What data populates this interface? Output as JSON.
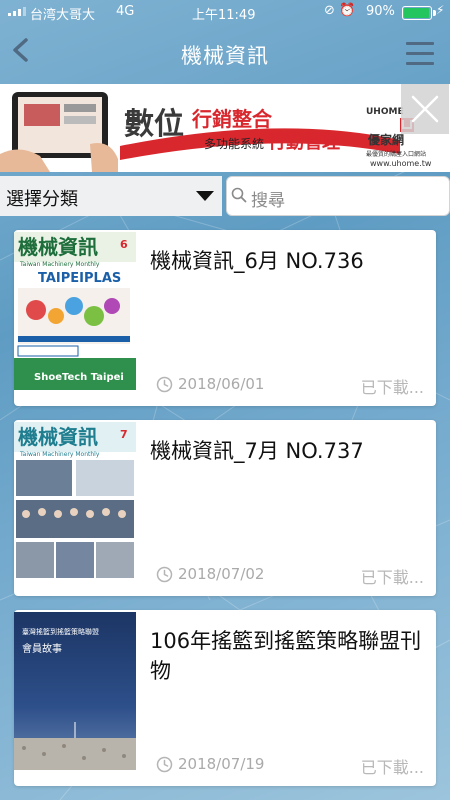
{
  "status_bar": {
    "carrier": "台湾大哥大",
    "network": "4G",
    "time": "上午11:49",
    "icons": "⊘ ⏰",
    "battery_percent": "90%",
    "battery_level": 0.9
  },
  "nav": {
    "title": "機械資訊",
    "back_icon": "chevron-left-icon",
    "menu_icon": "hamburger-menu-icon"
  },
  "banner": {
    "headline": "數位",
    "headline_red": "行銷整合",
    "subline": "多功能系統",
    "subline_red": "行動管理",
    "brand_latin": "UHOME",
    "brand_cn": "優家網",
    "brand_tagline": "最優質的購屋入口網站",
    "brand_url": "www.uhome.tw"
  },
  "filter": {
    "category_label": "選擇分類",
    "search_placeholder": "搜尋"
  },
  "items": [
    {
      "title": "機械資訊_6月 NO.736",
      "date": "2018/06/01",
      "status": "已下載...",
      "cover": {
        "masthead": "機械資訊",
        "subtitle": "Taiwan Machinery Monthly",
        "issue": "6",
        "headline": "TAIPEIPLAS",
        "footer": "ShoeTech Taipei"
      }
    },
    {
      "title": "機械資訊_7月 NO.737",
      "date": "2018/07/02",
      "status": "已下載...",
      "cover": {
        "masthead": "機械資訊",
        "subtitle": "Taiwan Machinery Monthly",
        "issue": "7",
        "headline": "",
        "footer": ""
      }
    },
    {
      "title": "106年搖籃到搖籃策略聯盟刊物",
      "date": "2018/07/19",
      "status": "已下載...",
      "cover": {
        "masthead": "臺灣搖籃到搖籃策略聯盟",
        "subtitle": "會員故事",
        "issue": "",
        "headline": "",
        "footer": ""
      }
    }
  ],
  "colors": {
    "background": "#6fa6c9",
    "nav_title": "#ffffff",
    "card": "#ffffff",
    "muted_text": "#aaaaaa",
    "banner_red": "#d9272e"
  }
}
